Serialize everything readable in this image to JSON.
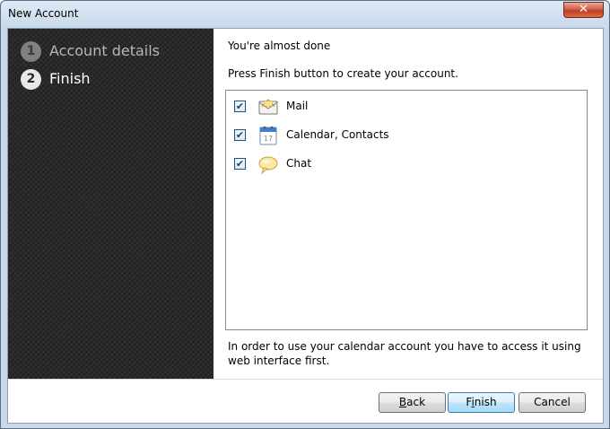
{
  "window": {
    "title": "New Account",
    "close_glyph": "✕"
  },
  "sidebar": {
    "steps": [
      {
        "number": "1",
        "label": "Account details",
        "state": "done"
      },
      {
        "number": "2",
        "label": "Finish",
        "state": "current"
      }
    ]
  },
  "main": {
    "heading": "You're almost done",
    "instruction": "Press Finish button to create your account.",
    "services": [
      {
        "label": "Mail",
        "checked": true,
        "icon": "mail-icon"
      },
      {
        "label": "Calendar, Contacts",
        "checked": true,
        "icon": "calendar-icon",
        "icon_text": "17"
      },
      {
        "label": "Chat",
        "checked": true,
        "icon": "chat-icon"
      }
    ],
    "note": "In order to use your calendar account you have to access it using web interface first."
  },
  "buttons": {
    "back": {
      "label": "Back",
      "mnemonic": "B",
      "rest": "ack"
    },
    "finish": {
      "label": "Finish",
      "mnemonic": "i",
      "pre": "F",
      "rest": "nish"
    },
    "cancel": {
      "label": "Cancel"
    }
  },
  "check_glyph": "✔"
}
